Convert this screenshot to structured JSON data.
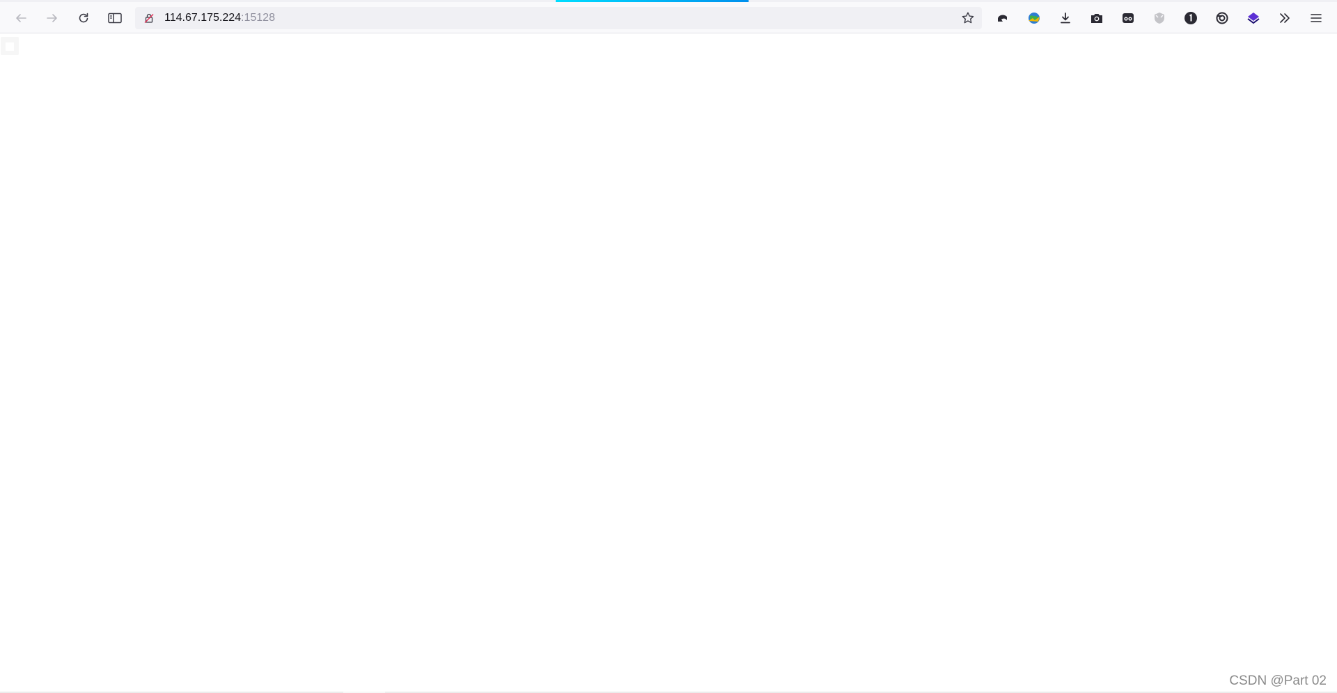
{
  "browser": {
    "url": {
      "host": "114.67.175.224",
      "port": ":15128"
    },
    "nav_icons": {
      "back": "back-arrow-icon",
      "forward": "forward-arrow-icon",
      "reload": "reload-icon",
      "sidebar": "sidebar-icon"
    },
    "toolbar_icons": [
      "undo-arrow-icon",
      "globe-extension-icon",
      "download-icon",
      "camera-icon",
      "ghost-extension-icon",
      "shield-extension-icon",
      "password-manager-icon",
      "copilot-icon",
      "stack-extension-icon",
      "overflow-chevrons-icon",
      "menu-icon"
    ],
    "loading_progress": 0.44,
    "accent_color": "#0090ed"
  },
  "watermark": "CSDN @Part 02"
}
